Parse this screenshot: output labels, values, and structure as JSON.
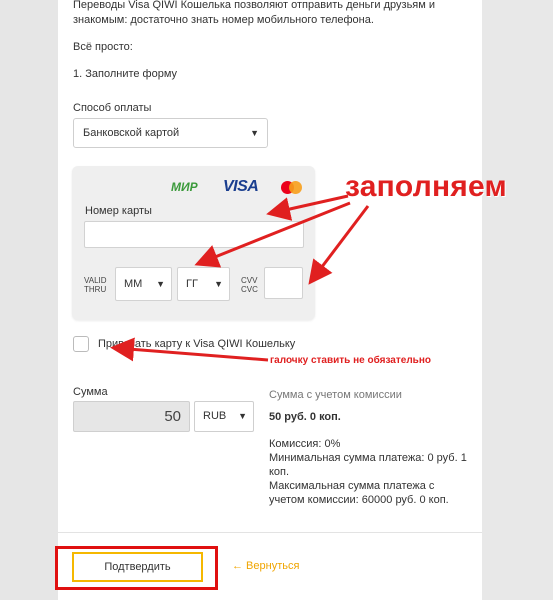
{
  "intro": {
    "line1": "Переводы Visa QIWI Кошелька позволяют отправить деньги друзьям и",
    "line2": "знакомым: достаточно знать номер мобильного телефона.",
    "simple": "Всё просто:",
    "step1": "1. Заполните форму"
  },
  "payment": {
    "label": "Способ оплаты",
    "selected": "Банковской картой"
  },
  "card": {
    "logos": [
      "МИР",
      "VISA",
      "mastercard"
    ],
    "number_label": "Номер карты",
    "number_value": "",
    "valid_thru_line1": "VALID",
    "valid_thru_line2": "THRU",
    "month_selected": "ММ",
    "year_selected": "ГГ",
    "cvv_line1": "CVV",
    "cvv_line2": "CVC",
    "cvv_value": ""
  },
  "bind_card": {
    "label": "Привязать карту к Visa QIWI Кошельку",
    "checked": false
  },
  "amount": {
    "label": "Сумма",
    "value": "50",
    "currency": "RUB"
  },
  "commission": {
    "title": "Сумма с учетом комиссии",
    "total": "50 руб. 0 коп.",
    "fee": "Комиссия: 0%",
    "min_line1": "Минимальная сумма платежа: 0 руб. 1",
    "min_line2": "коп.",
    "max_line1": "Максимальная сумма платежа с",
    "max_line2": "учетом комиссии: 60000 руб. 0 коп."
  },
  "actions": {
    "confirm": "Подтвердить",
    "back": "← Вернуться"
  },
  "annotations": {
    "fill_in": "заполняем",
    "checkbox_note": "галочку ставить не обязательно"
  },
  "colors": {
    "accent": "#f5b800",
    "annotation_red": "#e02020",
    "visa_blue": "#1a3e8f",
    "mir_green": "#3a9a3a"
  }
}
